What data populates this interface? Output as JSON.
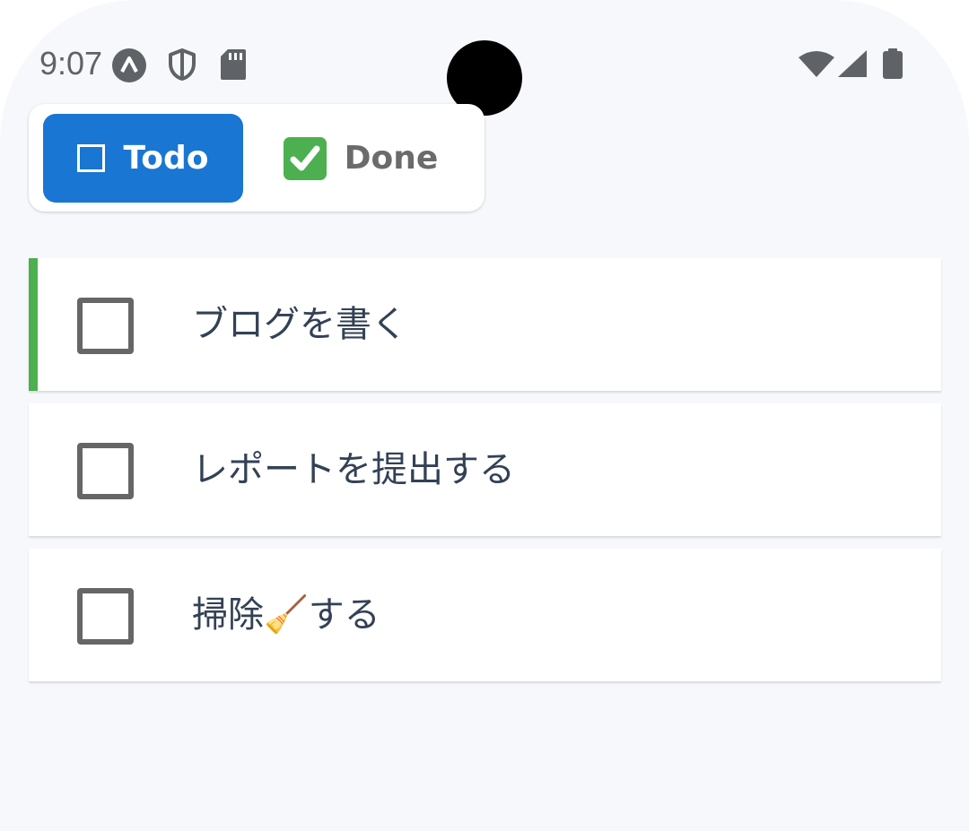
{
  "status_bar": {
    "time": "9:07",
    "icons": [
      "app-a-icon",
      "shield-icon",
      "sd-card-icon",
      "wifi-icon",
      "signal-icon",
      "battery-icon"
    ]
  },
  "tabs": [
    {
      "label": "Todo",
      "icon": "checkbox-outline-icon",
      "selected": true
    },
    {
      "label": "Done",
      "icon": "check-mark-button-icon",
      "selected": false
    }
  ],
  "tasks": [
    {
      "label": "ブログを書く",
      "checked": false,
      "highlighted": true
    },
    {
      "label": "レポートを提出する",
      "checked": false,
      "highlighted": false
    },
    {
      "label": "掃除🧹する",
      "checked": false,
      "highlighted": false
    }
  ],
  "colors": {
    "background": "#f6f8fc",
    "tab_selected": "#1976d2",
    "accent_bar": "#4caf50",
    "checkbox_border": "#666666",
    "task_text": "#334155"
  }
}
